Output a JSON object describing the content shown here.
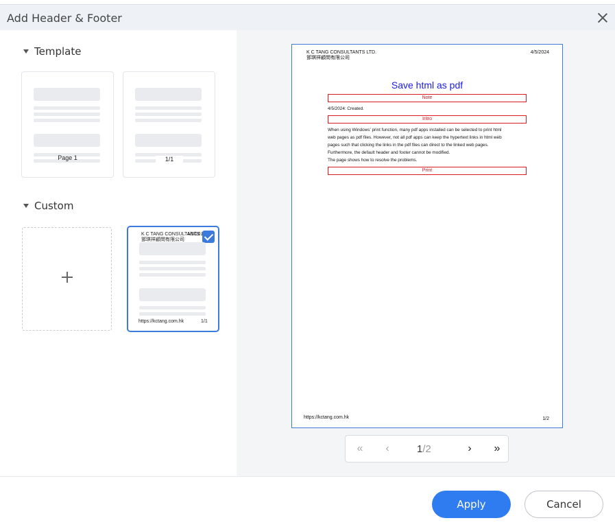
{
  "dialog": {
    "title": "Add Header & Footer"
  },
  "left": {
    "template_heading": "Template",
    "custom_heading": "Custom",
    "templates": [
      {
        "label": "Page 1"
      },
      {
        "label": "1/1"
      }
    ],
    "custom_card": {
      "header_company": "K C TANG CONSULTANTS LTD.",
      "header_company_cn": "鄧琪祥顧問有限公司",
      "header_date": "4/5/20...",
      "footer_left": "https://kctang.com.hk",
      "footer_right": "1/1"
    }
  },
  "preview": {
    "header_company": "K C TANG CONSULTANTS LTD.",
    "header_company_cn": "鄧琪祥顧問有限公司",
    "header_date": "4/5/2024",
    "doc_title": "Save html as pdf",
    "note_box": "Note",
    "note_text": "4/5/2024: Created.",
    "intro_box": "Intro",
    "intro_lines": [
      "When using Windows' print function, many pdf apps installed can be selected to print html",
      "web pages as pdf files. However, not all pdf apps can keep the hypertext links in html web",
      "pages such that clicking the links in the pdf files can direct to the linked web pages.",
      "Furthermore, the default header and footer cannot be modified.",
      "The page shows how to resolve the problems."
    ],
    "print_box": "Print",
    "footer_left": "https://kctang.com.hk",
    "footer_right": "1/2"
  },
  "pager": {
    "first": "«",
    "prev": "‹",
    "current": "1",
    "total": "/2",
    "next": "›",
    "last": "»"
  },
  "buttons": {
    "apply": "Apply",
    "cancel": "Cancel"
  },
  "colors": {
    "accent": "#2f7cf0",
    "doc_title": "#1a1ae6",
    "doc_red": "#e0171f"
  }
}
